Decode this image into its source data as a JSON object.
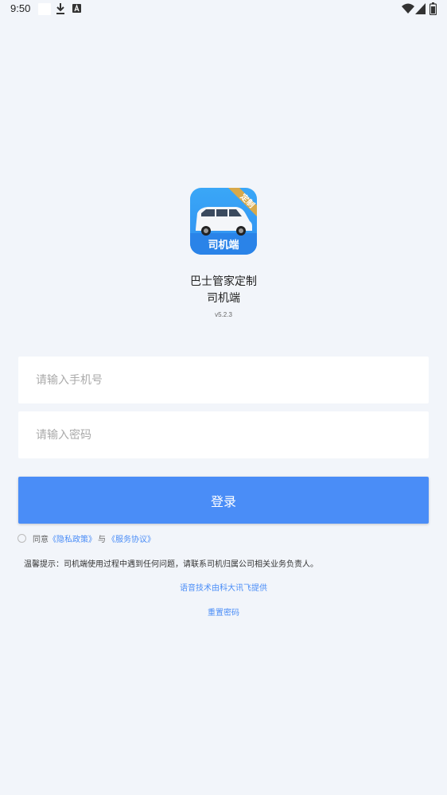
{
  "status_bar": {
    "time": "9:50"
  },
  "app": {
    "logo_label": "司机端",
    "logo_badge": "定制",
    "name_line1": "巴士管家定制",
    "name_line2": "司机端",
    "version": "v5.2.3"
  },
  "form": {
    "phone_placeholder": "请输入手机号",
    "password_placeholder": "请输入密码",
    "login_label": "登录"
  },
  "agreement": {
    "prefix": "同意",
    "privacy_link": "《隐私政策》",
    "and": "与",
    "service_link": "《服务协议》"
  },
  "tip": "温馨提示：司机端使用过程中遇到任何问题，请联系司机归属公司相关业务负责人。",
  "voice_credit": "语音技术由科大讯飞提供",
  "reset_password": "重置密码",
  "colors": {
    "accent": "#4a8df7",
    "background": "#f2f5fa"
  }
}
